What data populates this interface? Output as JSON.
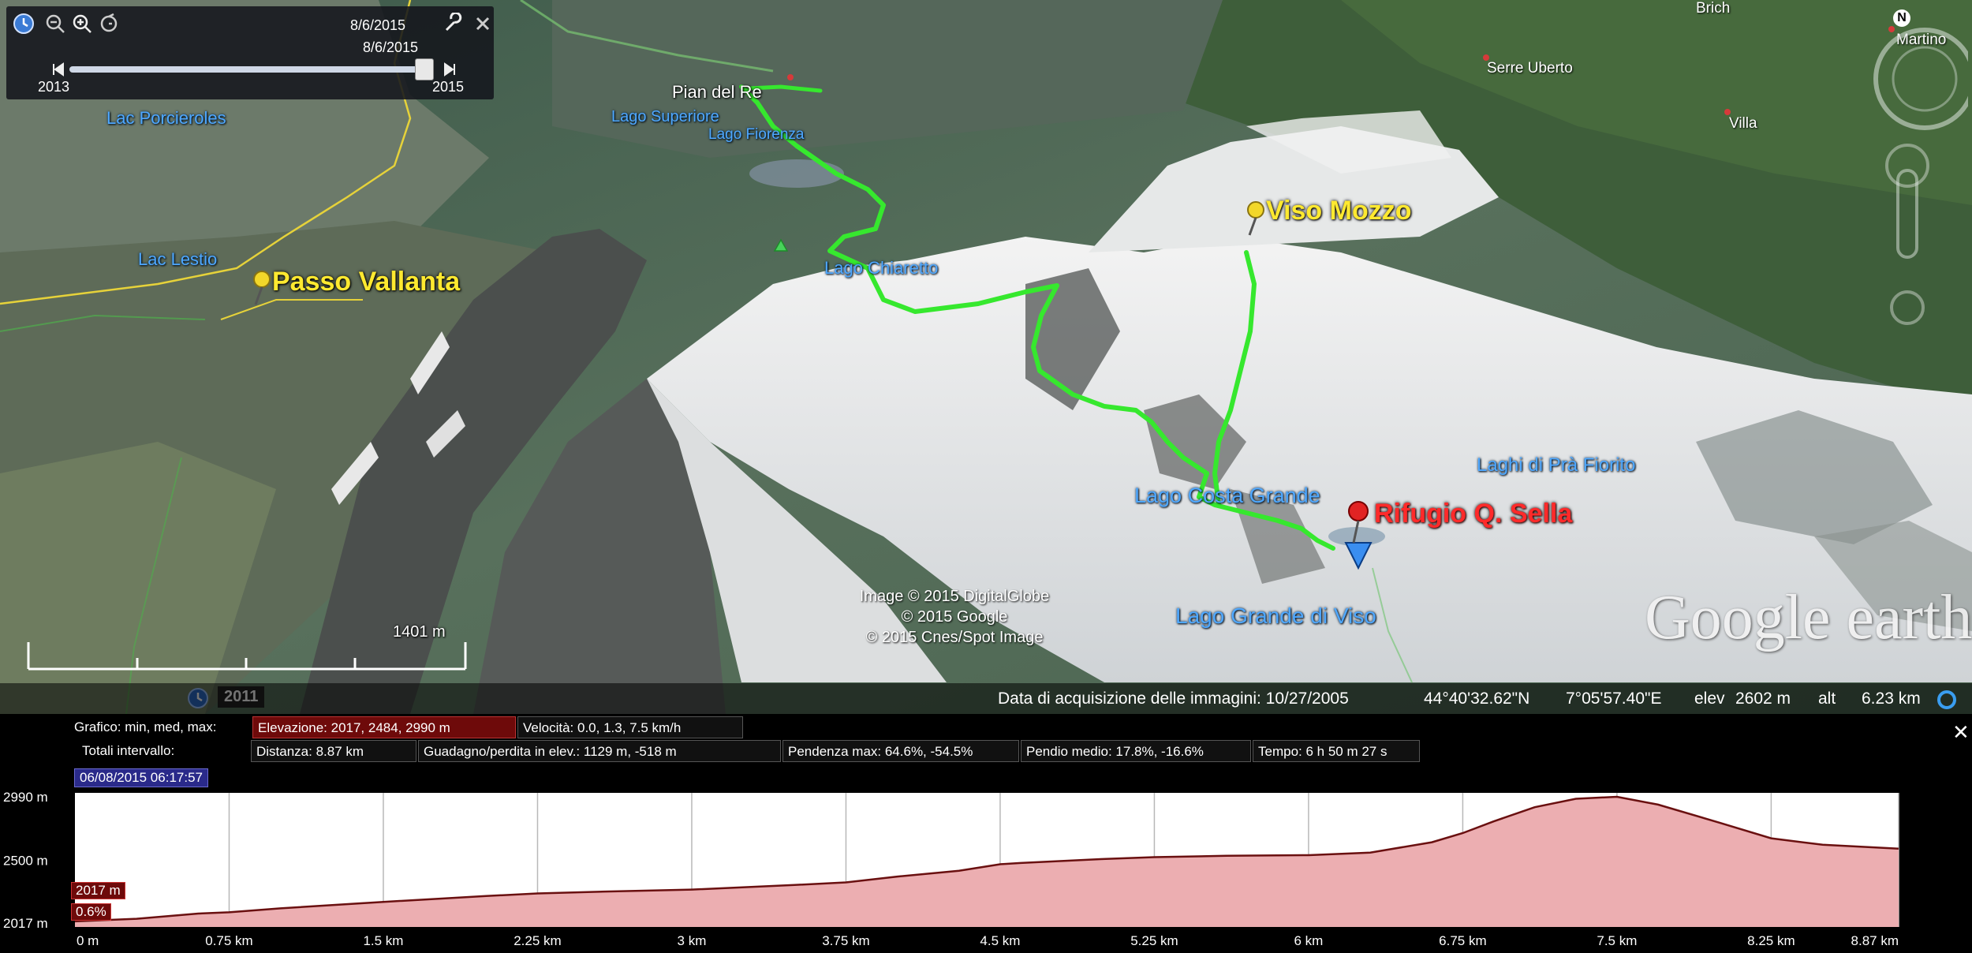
{
  "time_slider": {
    "date_top": "8/6/2015",
    "date_bottom": "8/6/2015",
    "year_start": "2013",
    "year_end": "2015"
  },
  "map": {
    "labels_blue": [
      {
        "id": "lac-porcieroles",
        "text": "Lac Porcieroles"
      },
      {
        "id": "lago-superiore",
        "text": "Lago Superiore"
      },
      {
        "id": "lago-fiorenza",
        "text": "Lago Fiorenza"
      },
      {
        "id": "lac-lestio",
        "text": "Lac Lestio"
      },
      {
        "id": "lago-chiaretto",
        "text": "Lago Chiaretto"
      },
      {
        "id": "laghi-pra-fiorito",
        "text": "Laghi di Prà Fiorito"
      },
      {
        "id": "lago-costa-grande",
        "text": "Lago Costa Grande"
      },
      {
        "id": "lago-grande-viso",
        "text": "Lago Grande di Viso"
      }
    ],
    "pian_del_re": "Pian del Re",
    "passo_vallanta": "Passo Vallanta",
    "viso_mozzo": "Viso Mozzo",
    "rifugio": "Rifugio Q. Sella",
    "towns": {
      "brich": "Brich",
      "serre_uberto": "Serre Uberto",
      "villa": "Villa",
      "martino": "Martino"
    },
    "copyright": [
      "Image © 2015 DigitalGlobe",
      "© 2015 Google",
      "© 2015 Cnes/Spot Image"
    ],
    "scale": "1401 m",
    "logo": "Google earth",
    "history_year": "2011",
    "compass": "N"
  },
  "status": {
    "acquisition": "Data di acquisizione delle immagini: 10/27/2005",
    "lat": "44°40'32.62\"N",
    "lon": "7°05'57.40\"E",
    "elev_label": "elev",
    "elev": "2602 m",
    "alt_label": "alt",
    "alt": "6.23 km"
  },
  "profile": {
    "graph_label": "Grafico: min, med, max:",
    "elevation": "Elevazione: 2017, 2484, 2990 m",
    "speed": "Velocità: 0.0, 1.3, 7.5 km/h",
    "totals_label": "Totali intervallo:",
    "distance": "Distanza: 8.87 km",
    "gain": "Guadagno/perdita in elev.: 1129 m, -518 m",
    "max_slope": "Pendenza max: 64.6%, -54.5%",
    "avg_slope": "Pendio medio: 17.8%, -16.6%",
    "time": "Tempo: 6 h 50 m 27 s",
    "timestamp": "06/08/2015 06:17:57",
    "close": "✕",
    "cursor_elev": "2017 m",
    "cursor_slope": "0.6%"
  },
  "chart_data": {
    "type": "area",
    "xlabel": "",
    "ylabel": "",
    "x_unit": "km",
    "xlim": [
      0,
      8.87
    ],
    "ylim": [
      2017,
      2990
    ],
    "y_ticks": [
      2017,
      2500,
      2990
    ],
    "y_tick_labels": [
      "2017 m",
      "2500 m",
      "2990 m"
    ],
    "x_ticks": [
      0,
      0.75,
      1.5,
      2.25,
      3,
      3.75,
      4.5,
      5.25,
      6,
      6.75,
      7.5,
      8.25,
      8.87
    ],
    "x_tick_labels": [
      "0 m",
      "0.75 km",
      "1.5 km",
      "2.25 km",
      "3 km",
      "3.75 km",
      "4.5 km",
      "5.25 km",
      "6 km",
      "6.75 km",
      "7.5 km",
      "8.25 km",
      "8.87 km"
    ],
    "grid": true,
    "x": [
      0,
      0.3,
      0.6,
      0.75,
      1.0,
      1.5,
      2.0,
      2.25,
      2.6,
      3.0,
      3.5,
      3.75,
      4.0,
      4.3,
      4.5,
      4.6,
      5.0,
      5.25,
      5.6,
      6.0,
      6.3,
      6.6,
      6.75,
      6.9,
      7.1,
      7.3,
      7.5,
      7.7,
      8.0,
      8.25,
      8.5,
      8.87
    ],
    "values": [
      2030,
      2050,
      2090,
      2100,
      2130,
      2180,
      2225,
      2245,
      2260,
      2275,
      2310,
      2330,
      2375,
      2420,
      2470,
      2480,
      2510,
      2525,
      2535,
      2540,
      2560,
      2640,
      2710,
      2800,
      2910,
      2975,
      2990,
      2930,
      2790,
      2670,
      2620,
      2590
    ],
    "color": "#e9a3a6"
  }
}
